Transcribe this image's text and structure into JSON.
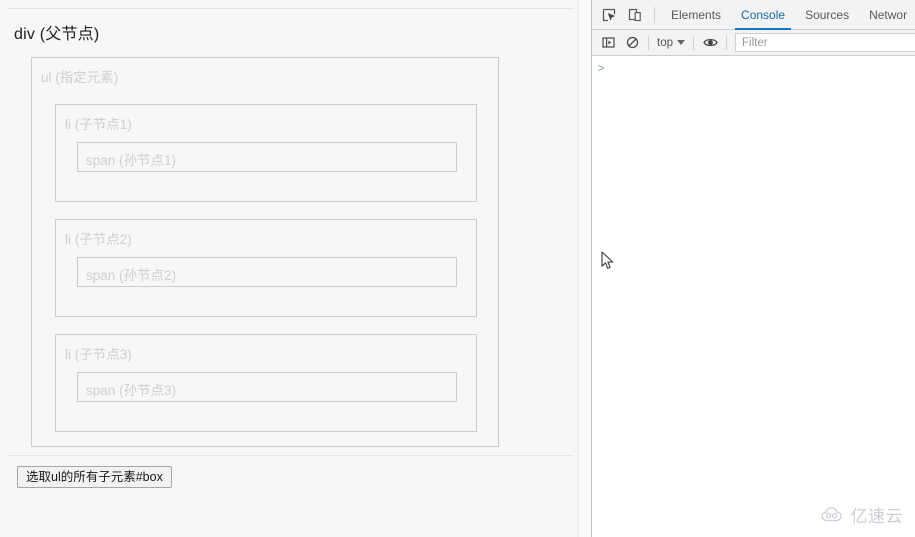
{
  "page": {
    "div_title": "div (父节点)",
    "ul_label": "ul (指定元素)",
    "items": [
      {
        "li_label": "li (子节点1)",
        "span_label": "span (孙节点1)"
      },
      {
        "li_label": "li (子节点2)",
        "span_label": "span (孙节点2)"
      },
      {
        "li_label": "li (子节点3)",
        "span_label": "span (孙节点3)"
      }
    ],
    "button_label": "选取ul的所有子元素#box"
  },
  "devtools": {
    "inspect_icon": "inspect-element-icon",
    "device_icon": "device-toolbar-icon",
    "tabs": [
      {
        "label": "Elements",
        "active": false
      },
      {
        "label": "Console",
        "active": true
      },
      {
        "label": "Sources",
        "active": false
      },
      {
        "label": "Networ",
        "active": false
      }
    ],
    "toolbar": {
      "sidebar_icon": "console-sidebar-icon",
      "clear_icon": "clear-console-icon",
      "context_label": "top",
      "caret_icon": "chevron-down-icon",
      "eye_icon": "live-expression-eye-icon",
      "filter_placeholder": "Filter",
      "filter_value": ""
    },
    "console": {
      "prompt_chevron": ">",
      "input_value": ""
    }
  },
  "watermark": {
    "text": "亿速云",
    "logo": "cloud-icon"
  },
  "colors": {
    "accent": "#1a73c8",
    "page_bg": "#f7f7f7",
    "box_border": "#cccccc",
    "box_text": "#cfcfcf",
    "devtools_bg": "#f3f3f3"
  }
}
